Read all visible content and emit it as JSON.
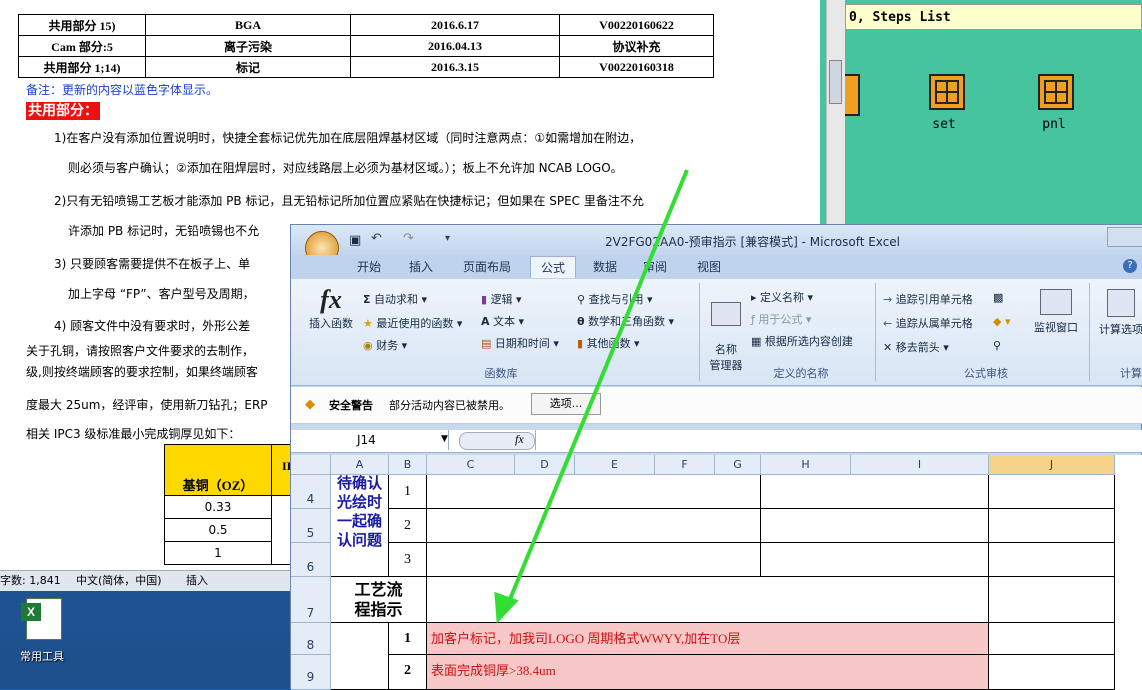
{
  "cam": {
    "title": "0, Steps List",
    "steps": [
      {
        "label": "set"
      },
      {
        "label": "pnl"
      }
    ]
  },
  "word": {
    "table_rows": [
      [
        "共用部分 15)",
        "BGA",
        "2016.6.17",
        "V00220160622"
      ],
      [
        "Cam 部分:5",
        "离子污染",
        "2016.04.13",
        "协议补充"
      ],
      [
        "共用部分 1;14)",
        "标记",
        "2016.3.15",
        "V00220160318"
      ]
    ],
    "note": "备注：更新的内容以蓝色字体显示。",
    "section_heading": "共用部分：",
    "p1a": "1)在客户没有添加位置说明时，快捷全套标记优先加在底层阻焊基材区域（同时注意两点：①如需增加在附边，",
    "p1b": "则必须与客户确认；②添加在阻焊层时，对应线路层上必须为基材区域。）；板上不允许加 NCAB LOGO。",
    "p2a": "2)只有无铅喷锡工艺板才能添加 PB 标记，且无铅标记所加位置应紧贴在快捷标记；但如果在 SPEC 里备注不允",
    "p2b": "许添加 PB 标记时，无铅喷锡也不允",
    "p3a": "3)  只要顾客需要提供不在板子上、单",
    "p3b": "加上字母 “FP”、客户型号及周期，",
    "p4": "4) 顾客文件中没有要求时，外形公差",
    "p5a": "关于孔铜，请按照客户文件要求的去制作，",
    "p5b": "级,则按终端顾客的要求控制，如果终端顾客",
    "p6": "度最大 25um，经评审，使用新刀钻孔；ERP",
    "p7": "相关 IPC3 级标准最小完成铜厚见如下：",
    "copper_header": "基铜（OZ）",
    "copper_header2": "II",
    "copper_rows": [
      "0.33",
      "0.5",
      "1"
    ],
    "status": {
      "words": "字数: 1,841",
      "lang": "中文(简体，中国)",
      "mode": "插入"
    }
  },
  "desktop": {
    "icon_label": "常用工具"
  },
  "excel": {
    "title": "2V2FG02AA0-预审指示  [兼容模式] - Microsoft Excel",
    "tabs": [
      "开始",
      "插入",
      "页面布局",
      "公式",
      "数据",
      "审阅",
      "视图"
    ],
    "active_tab": "公式",
    "ribbon": {
      "insert_fn": "插入函数",
      "autosum": "自动求和",
      "recent": "最近使用的函数",
      "finance": "财务",
      "logic": "逻辑",
      "text": "文本",
      "datetime": "日期和时间",
      "lookup": "查找与引用",
      "math": "数学和三角函数",
      "other": "其他函数",
      "group_lib": "函数库",
      "name_mgr": "名称\n管理器",
      "define": "定义名称",
      "use_in": "用于公式",
      "create": "根据所选内容创建",
      "group_names": "定义的名称",
      "trace_prec": "追踪引用单元格",
      "trace_dep": "追踪从属单元格",
      "remove_arrows": "移去箭头",
      "watch": "监视窗口",
      "group_audit": "公式审核",
      "calc": "计算选项",
      "group_calc": "计算"
    },
    "warning": {
      "label": "安全警告",
      "text": "部分活动内容已被禁用。",
      "button": "选项..."
    },
    "namebox": "J14",
    "fx": "fx",
    "columns": [
      "A",
      "B",
      "C",
      "D",
      "E",
      "F",
      "G",
      "H",
      "I",
      "J"
    ],
    "rows": [
      "4",
      "5",
      "6",
      "7",
      "8",
      "9"
    ],
    "cells": {
      "a456": "待确认光绘时一起确认问题",
      "b4": "1",
      "b5": "2",
      "b6": "3",
      "a7": "工艺流程指示",
      "b8": "1",
      "b9": "2",
      "c8": "加客户标记，加我司LOGO 周期格式WWYY,加在TO层",
      "c9": "表面完成铜厚>38.4um"
    },
    "colors": {
      "pink": "#f8c8c8",
      "blue_text": "#1a1aa6",
      "selected_col": "#f5d48a"
    }
  },
  "arrow_color": "#33dd33"
}
